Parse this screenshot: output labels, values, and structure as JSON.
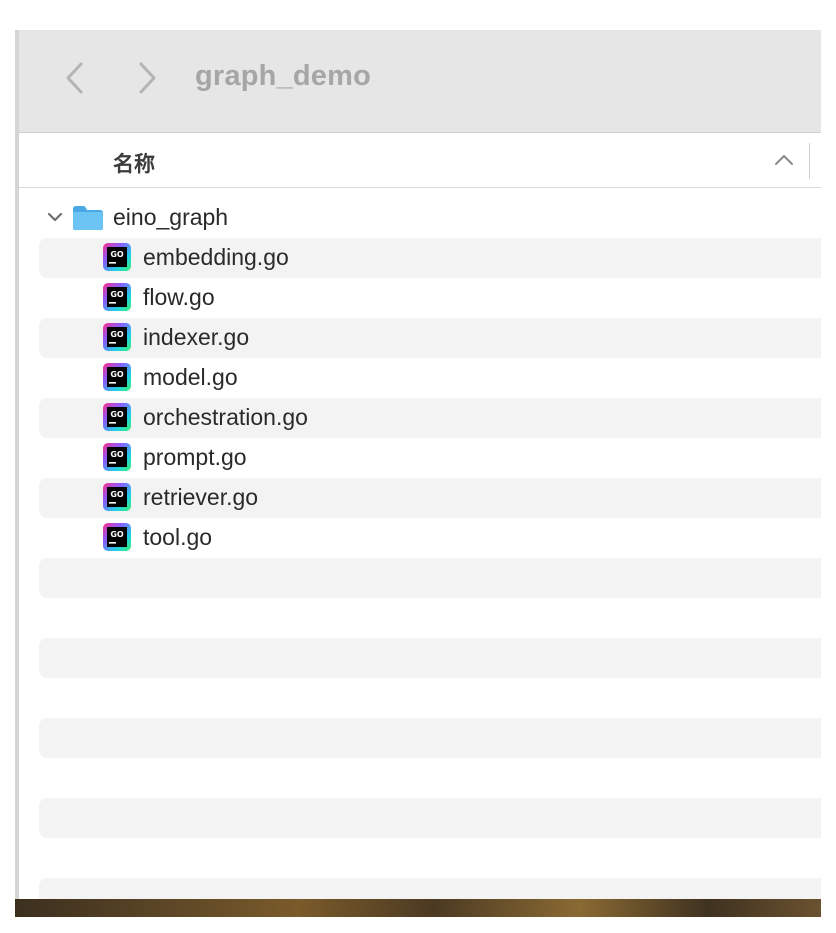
{
  "window": {
    "title": "graph_demo"
  },
  "column_header": {
    "name_label": "名称"
  },
  "folder": {
    "name": "eino_graph",
    "expanded": true
  },
  "files": [
    {
      "name": "embedding.go",
      "icon": "goland-go-file-icon"
    },
    {
      "name": "flow.go",
      "icon": "goland-go-file-icon"
    },
    {
      "name": "indexer.go",
      "icon": "goland-go-file-icon"
    },
    {
      "name": "model.go",
      "icon": "goland-go-file-icon"
    },
    {
      "name": "orchestration.go",
      "icon": "goland-go-file-icon"
    },
    {
      "name": "prompt.go",
      "icon": "goland-go-file-icon"
    },
    {
      "name": "retriever.go",
      "icon": "goland-go-file-icon"
    },
    {
      "name": "tool.go",
      "icon": "goland-go-file-icon"
    }
  ],
  "icons": {
    "back": "chevron-left-icon",
    "forward": "chevron-right-icon",
    "sort": "chevron-up-icon",
    "disclosure": "chevron-down-icon",
    "folder": "folder-icon"
  },
  "colors": {
    "folder_blue": "#5ab8f0",
    "row_stripe": "#f3f3f3",
    "toolbar_bg": "#e6e6e6"
  }
}
